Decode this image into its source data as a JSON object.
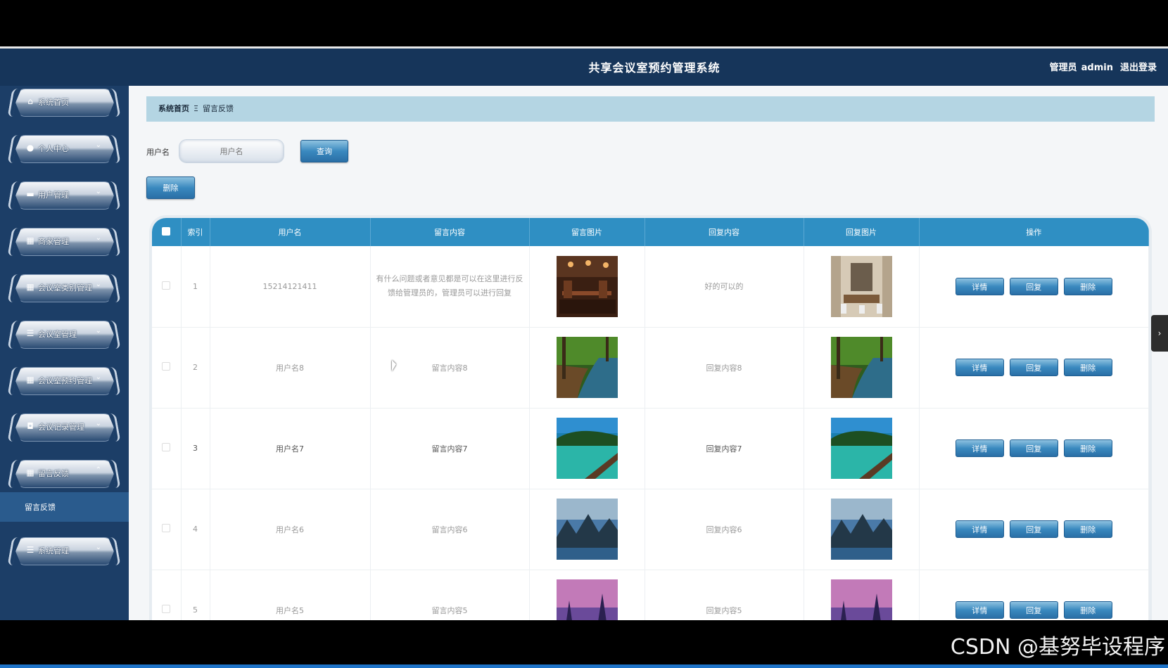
{
  "header": {
    "title": "共享会议室预约管理系统",
    "role": "管理员",
    "username": "admin",
    "logout": "退出登录"
  },
  "sidebar": {
    "items": [
      {
        "label": "系统首页",
        "icon": "home-icon"
      },
      {
        "label": "个人中心",
        "icon": "person-icon"
      },
      {
        "label": "用户管理",
        "icon": "monitor-icon"
      },
      {
        "label": "商家管理",
        "icon": "grid-icon"
      },
      {
        "label": "会议室类别管理",
        "icon": "grid-icon"
      },
      {
        "label": "会议室管理",
        "icon": "list-icon"
      },
      {
        "label": "会议室预约管理",
        "icon": "grid-icon"
      },
      {
        "label": "会议记录管理",
        "icon": "briefcase-icon"
      },
      {
        "label": "留言反馈",
        "icon": "grid-icon"
      },
      {
        "label": "系统管理",
        "icon": "list-icon"
      }
    ],
    "sub_item": "留言反馈"
  },
  "breadcrumb": {
    "home": "系统首页",
    "separator": "Ξ",
    "current": "留言反馈"
  },
  "search": {
    "label": "用户名",
    "placeholder": "用户名",
    "button": "查询"
  },
  "toolbar": {
    "delete_label": "删除"
  },
  "table": {
    "columns": [
      "",
      "索引",
      "用户名",
      "留言内容",
      "留言图片",
      "回复内容",
      "回复图片",
      "操作"
    ],
    "actions": {
      "detail": "详情",
      "reply": "回复",
      "delete": "删除"
    },
    "rows": [
      {
        "index": "1",
        "username": "15214121411",
        "content": "有什么问题或者意见都是可以在这里进行反馈给管理员的，管理员可以进行回复",
        "reply": "好的可以的",
        "image": "restaurant",
        "reply_image": "meeting-room"
      },
      {
        "index": "2",
        "username": "用户名8",
        "content": "留言内容8",
        "reply": "回复内容8",
        "image": "forest-river",
        "reply_image": "forest-river"
      },
      {
        "index": "3",
        "username": "用户名7",
        "content": "留言内容7",
        "reply": "回复内容7",
        "image": "pier-lake",
        "reply_image": "pier-lake"
      },
      {
        "index": "4",
        "username": "用户名6",
        "content": "留言内容6",
        "reply": "回复内容6",
        "image": "mountain-lake",
        "reply_image": "mountain-lake"
      },
      {
        "index": "5",
        "username": "用户名5",
        "content": "留言内容5",
        "reply": "回复内容5",
        "image": "purple-forest",
        "reply_image": "purple-forest"
      }
    ]
  },
  "watermark": "CSDN @基努毕设程序"
}
